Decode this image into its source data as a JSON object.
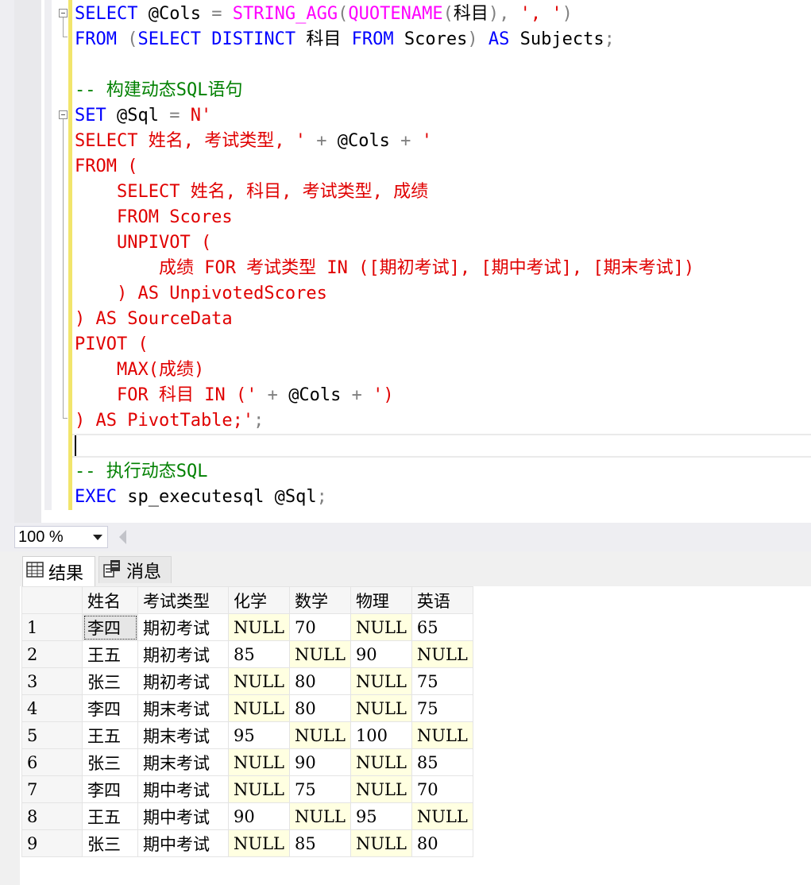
{
  "editor": {
    "lines": [
      [
        {
          "t": "SELECT ",
          "c": "kw"
        },
        {
          "t": "@Cols ",
          "c": "pl"
        },
        {
          "t": "= ",
          "c": "op"
        },
        {
          "t": "STRING_AGG",
          "c": "fn"
        },
        {
          "t": "(",
          "c": "op"
        },
        {
          "t": "QUOTENAME",
          "c": "fn"
        },
        {
          "t": "(",
          "c": "op"
        },
        {
          "t": "科目",
          "c": "pl"
        },
        {
          "t": "), ",
          "c": "op"
        },
        {
          "t": "', '",
          "c": "str"
        },
        {
          "t": ")",
          "c": "op"
        }
      ],
      [
        {
          "t": "FROM ",
          "c": "kw"
        },
        {
          "t": "(",
          "c": "op"
        },
        {
          "t": "SELECT DISTINCT ",
          "c": "kw"
        },
        {
          "t": "科目 ",
          "c": "pl"
        },
        {
          "t": "FROM ",
          "c": "kw"
        },
        {
          "t": "Scores",
          "c": "pl"
        },
        {
          "t": ") ",
          "c": "op"
        },
        {
          "t": "AS ",
          "c": "kw"
        },
        {
          "t": "Subjects",
          "c": "pl"
        },
        {
          "t": ";",
          "c": "op"
        }
      ],
      [],
      [
        {
          "t": "-- 构建动态SQL语句",
          "c": "cm"
        }
      ],
      [
        {
          "t": "SET ",
          "c": "kw"
        },
        {
          "t": "@Sql ",
          "c": "pl"
        },
        {
          "t": "= ",
          "c": "op"
        },
        {
          "t": "N'",
          "c": "str"
        }
      ],
      [
        {
          "t": "SELECT 姓名, 考试类型, '",
          "c": "str"
        },
        {
          "t": " + ",
          "c": "op"
        },
        {
          "t": "@Cols",
          "c": "pl"
        },
        {
          "t": " + ",
          "c": "op"
        },
        {
          "t": "'",
          "c": "str"
        }
      ],
      [
        {
          "t": "FROM (",
          "c": "str"
        }
      ],
      [
        {
          "t": "    SELECT 姓名, 科目, 考试类型, 成绩",
          "c": "str"
        }
      ],
      [
        {
          "t": "    FROM Scores",
          "c": "str"
        }
      ],
      [
        {
          "t": "    UNPIVOT (",
          "c": "str"
        }
      ],
      [
        {
          "t": "        成绩 FOR 考试类型 IN ([期初考试], [期中考试], [期末考试])",
          "c": "str"
        }
      ],
      [
        {
          "t": "    ) AS UnpivotedScores",
          "c": "str"
        }
      ],
      [
        {
          "t": ") AS SourceData",
          "c": "str"
        }
      ],
      [
        {
          "t": "PIVOT (",
          "c": "str"
        }
      ],
      [
        {
          "t": "    MAX(成绩)",
          "c": "str"
        }
      ],
      [
        {
          "t": "    FOR 科目 IN (",
          "c": "str"
        },
        {
          "t": "'",
          "c": "str"
        },
        {
          "t": " + ",
          "c": "op"
        },
        {
          "t": "@Cols",
          "c": "pl"
        },
        {
          "t": " + ",
          "c": "op"
        },
        {
          "t": "')",
          "c": "str"
        }
      ],
      [
        {
          "t": ") AS PivotTable;'",
          "c": "str"
        },
        {
          "t": ";",
          "c": "op"
        }
      ],
      [],
      [
        {
          "t": "-- 执行动态SQL",
          "c": "cm"
        }
      ],
      [
        {
          "t": "EXEC ",
          "c": "kw"
        },
        {
          "t": "sp_executesql ",
          "c": "pl"
        },
        {
          "t": "@Sql",
          "c": "pl"
        },
        {
          "t": ";",
          "c": "op"
        }
      ]
    ]
  },
  "zoom": {
    "value": "100 %"
  },
  "tabs": {
    "results": "结果",
    "messages": "消息"
  },
  "grid": {
    "headers": [
      "",
      "姓名",
      "考试类型",
      "化学",
      "数学",
      "物理",
      "英语"
    ],
    "rows": [
      [
        "1",
        "李四",
        "期初考试",
        "NULL",
        "70",
        "NULL",
        "65"
      ],
      [
        "2",
        "王五",
        "期初考试",
        "85",
        "NULL",
        "90",
        "NULL"
      ],
      [
        "3",
        "张三",
        "期初考试",
        "NULL",
        "80",
        "NULL",
        "75"
      ],
      [
        "4",
        "李四",
        "期末考试",
        "NULL",
        "80",
        "NULL",
        "75"
      ],
      [
        "5",
        "王五",
        "期末考试",
        "95",
        "NULL",
        "100",
        "NULL"
      ],
      [
        "6",
        "张三",
        "期末考试",
        "NULL",
        "90",
        "NULL",
        "85"
      ],
      [
        "7",
        "李四",
        "期中考试",
        "NULL",
        "75",
        "NULL",
        "70"
      ],
      [
        "8",
        "王五",
        "期中考试",
        "90",
        "NULL",
        "95",
        "NULL"
      ],
      [
        "9",
        "张三",
        "期中考试",
        "NULL",
        "85",
        "NULL",
        "80"
      ]
    ]
  },
  "colors": {
    "keyword": "#0000ff",
    "string": "#e00000",
    "function": "#ff00ff",
    "comment": "#008000",
    "null_cell": "#ffffe1"
  }
}
